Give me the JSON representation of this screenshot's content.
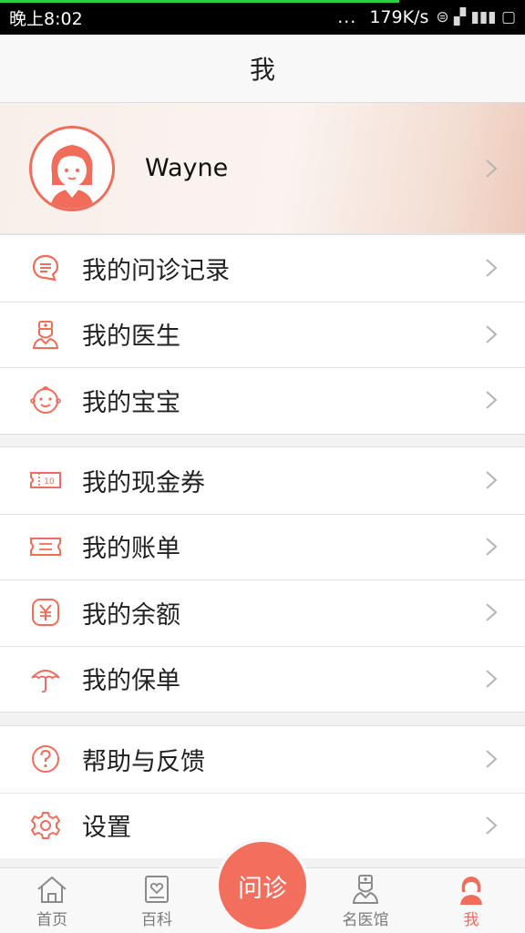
{
  "status_bar": {
    "time": "晚上8:02",
    "dots": "...",
    "speed": "179K/s",
    "system_icons": "⊜ ▞ ▮▮▮ ▢"
  },
  "nav": {
    "title": "我"
  },
  "profile": {
    "username": "Wayne"
  },
  "menu_group_1": [
    {
      "label": "我的问诊记录",
      "icon": "chat-bubble-icon"
    },
    {
      "label": "我的医生",
      "icon": "doctor-icon"
    },
    {
      "label": "我的宝宝",
      "icon": "baby-face-icon"
    }
  ],
  "menu_group_2": [
    {
      "label": "我的现金券",
      "icon": "voucher-icon"
    },
    {
      "label": "我的账单",
      "icon": "bill-icon"
    },
    {
      "label": "我的余额",
      "icon": "yuan-balance-icon"
    },
    {
      "label": "我的保单",
      "icon": "umbrella-icon"
    }
  ],
  "menu_group_3": [
    {
      "label": "帮助与反馈",
      "icon": "help-icon"
    },
    {
      "label": "设置",
      "icon": "gear-icon"
    }
  ],
  "tabbar": {
    "home": "首页",
    "wiki": "百科",
    "consult": "问诊",
    "doctors": "名医馆",
    "me": "我"
  },
  "colors": {
    "accent": "#f06d5c",
    "active_tab": "#f06d5c",
    "inactive_tab": "#7a7a7a",
    "status_progress": "#2ecc40"
  }
}
